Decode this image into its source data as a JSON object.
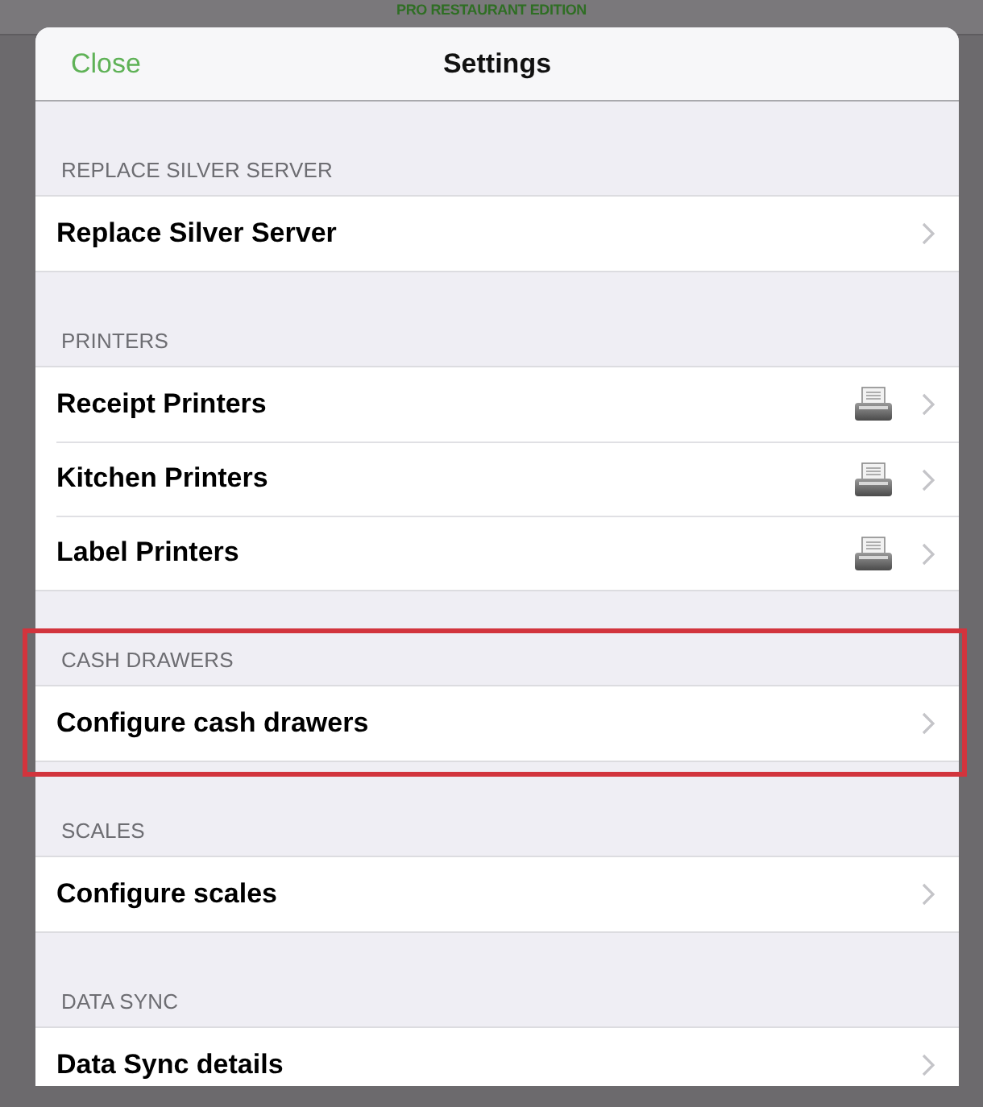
{
  "top_bar": {
    "title": "PRO RESTAURANT EDITION"
  },
  "header": {
    "close": "Close",
    "title": "Settings"
  },
  "sections": [
    {
      "title": "REPLACE SILVER SERVER",
      "highlighted": false,
      "rows": [
        {
          "label": "Replace Silver Server",
          "kind": "plain"
        }
      ]
    },
    {
      "title": "PRINTERS",
      "highlighted": false,
      "rows": [
        {
          "label": "Receipt Printers",
          "kind": "printer"
        },
        {
          "label": "Kitchen Printers",
          "kind": "printer"
        },
        {
          "label": "Label Printers",
          "kind": "printer"
        }
      ]
    },
    {
      "title": "CASH DRAWERS",
      "highlighted": true,
      "rows": [
        {
          "label": "Configure cash drawers",
          "kind": "plain"
        }
      ]
    },
    {
      "title": "SCALES",
      "highlighted": false,
      "rows": [
        {
          "label": "Configure scales",
          "kind": "plain"
        }
      ]
    },
    {
      "title": "DATA SYNC",
      "highlighted": false,
      "rows": [
        {
          "label": "Data Sync details",
          "kind": "plain"
        }
      ]
    }
  ]
}
